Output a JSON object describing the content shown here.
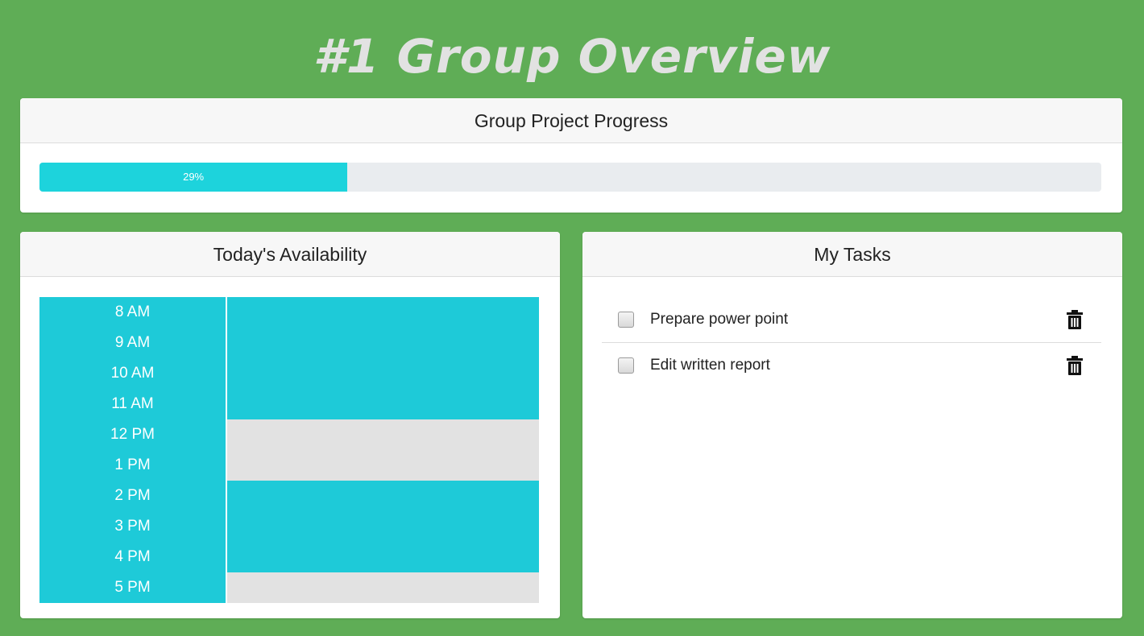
{
  "header": {
    "title": "#1 Group Overview"
  },
  "progress": {
    "title": "Group Project Progress",
    "value": 0.29,
    "label": "29%",
    "color": "#1dd3dc"
  },
  "availability": {
    "title": "Today's Availability",
    "times": [
      "8 AM",
      "9 AM",
      "10 AM",
      "11 AM",
      "12 PM",
      "1 PM",
      "2 PM",
      "3 PM",
      "4 PM",
      "5 PM"
    ],
    "slots": [
      "available",
      "available",
      "available",
      "available",
      "busy",
      "busy",
      "available",
      "available",
      "available",
      "busy"
    ],
    "colors": {
      "available": "#1ecad8",
      "busy": "#e2e2e2"
    }
  },
  "tasks": {
    "title": "My Tasks",
    "items": [
      {
        "label": "Prepare power point",
        "checked": false,
        "icon": "trash-icon"
      },
      {
        "label": "Edit written report",
        "checked": false,
        "icon": "trash-icon"
      }
    ]
  },
  "colors": {
    "background": "#5fad56",
    "title_text": "#e2e2e2"
  }
}
